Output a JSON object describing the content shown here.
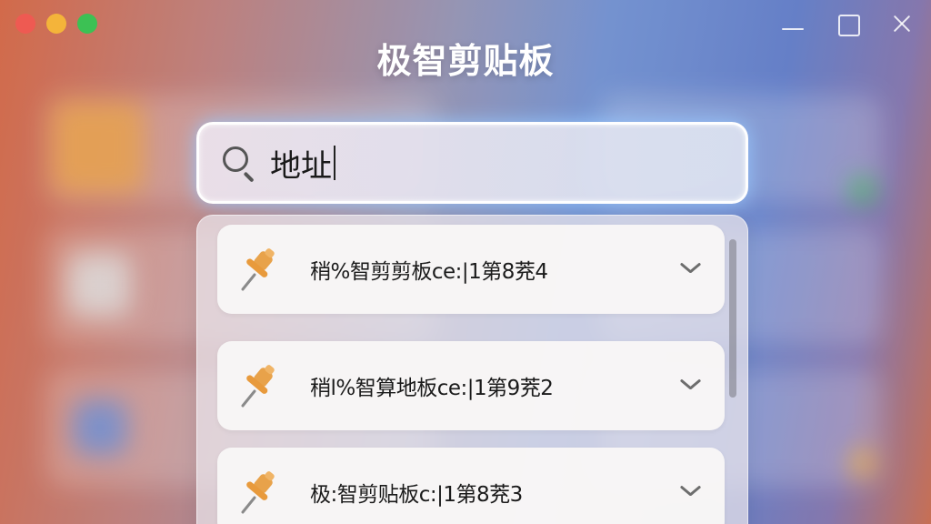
{
  "app": {
    "title": "极智剪贴板"
  },
  "window": {
    "controls": [
      "close",
      "minimize",
      "maximize"
    ]
  },
  "search": {
    "value": "地址",
    "icon": "search-icon"
  },
  "results": [
    {
      "text": "稍%智剪剪板ce:|1第8茺4",
      "icon": "pin-icon",
      "expand_icon": "chevron-down-icon"
    },
    {
      "text": "稍l%智算地板ce:|1第9茺2",
      "icon": "pin-icon",
      "expand_icon": "chevron-down-icon"
    },
    {
      "text": "极:智剪贴板c:|1第8茺3",
      "icon": "pin-icon",
      "expand_icon": "chevron-down-icon"
    }
  ],
  "colors": {
    "accent_pin": "#e8a24a",
    "search_glow": "#96c8ff",
    "traffic_close": "#ee5a52",
    "traffic_min": "#f4b43a",
    "traffic_max": "#3cc154"
  }
}
